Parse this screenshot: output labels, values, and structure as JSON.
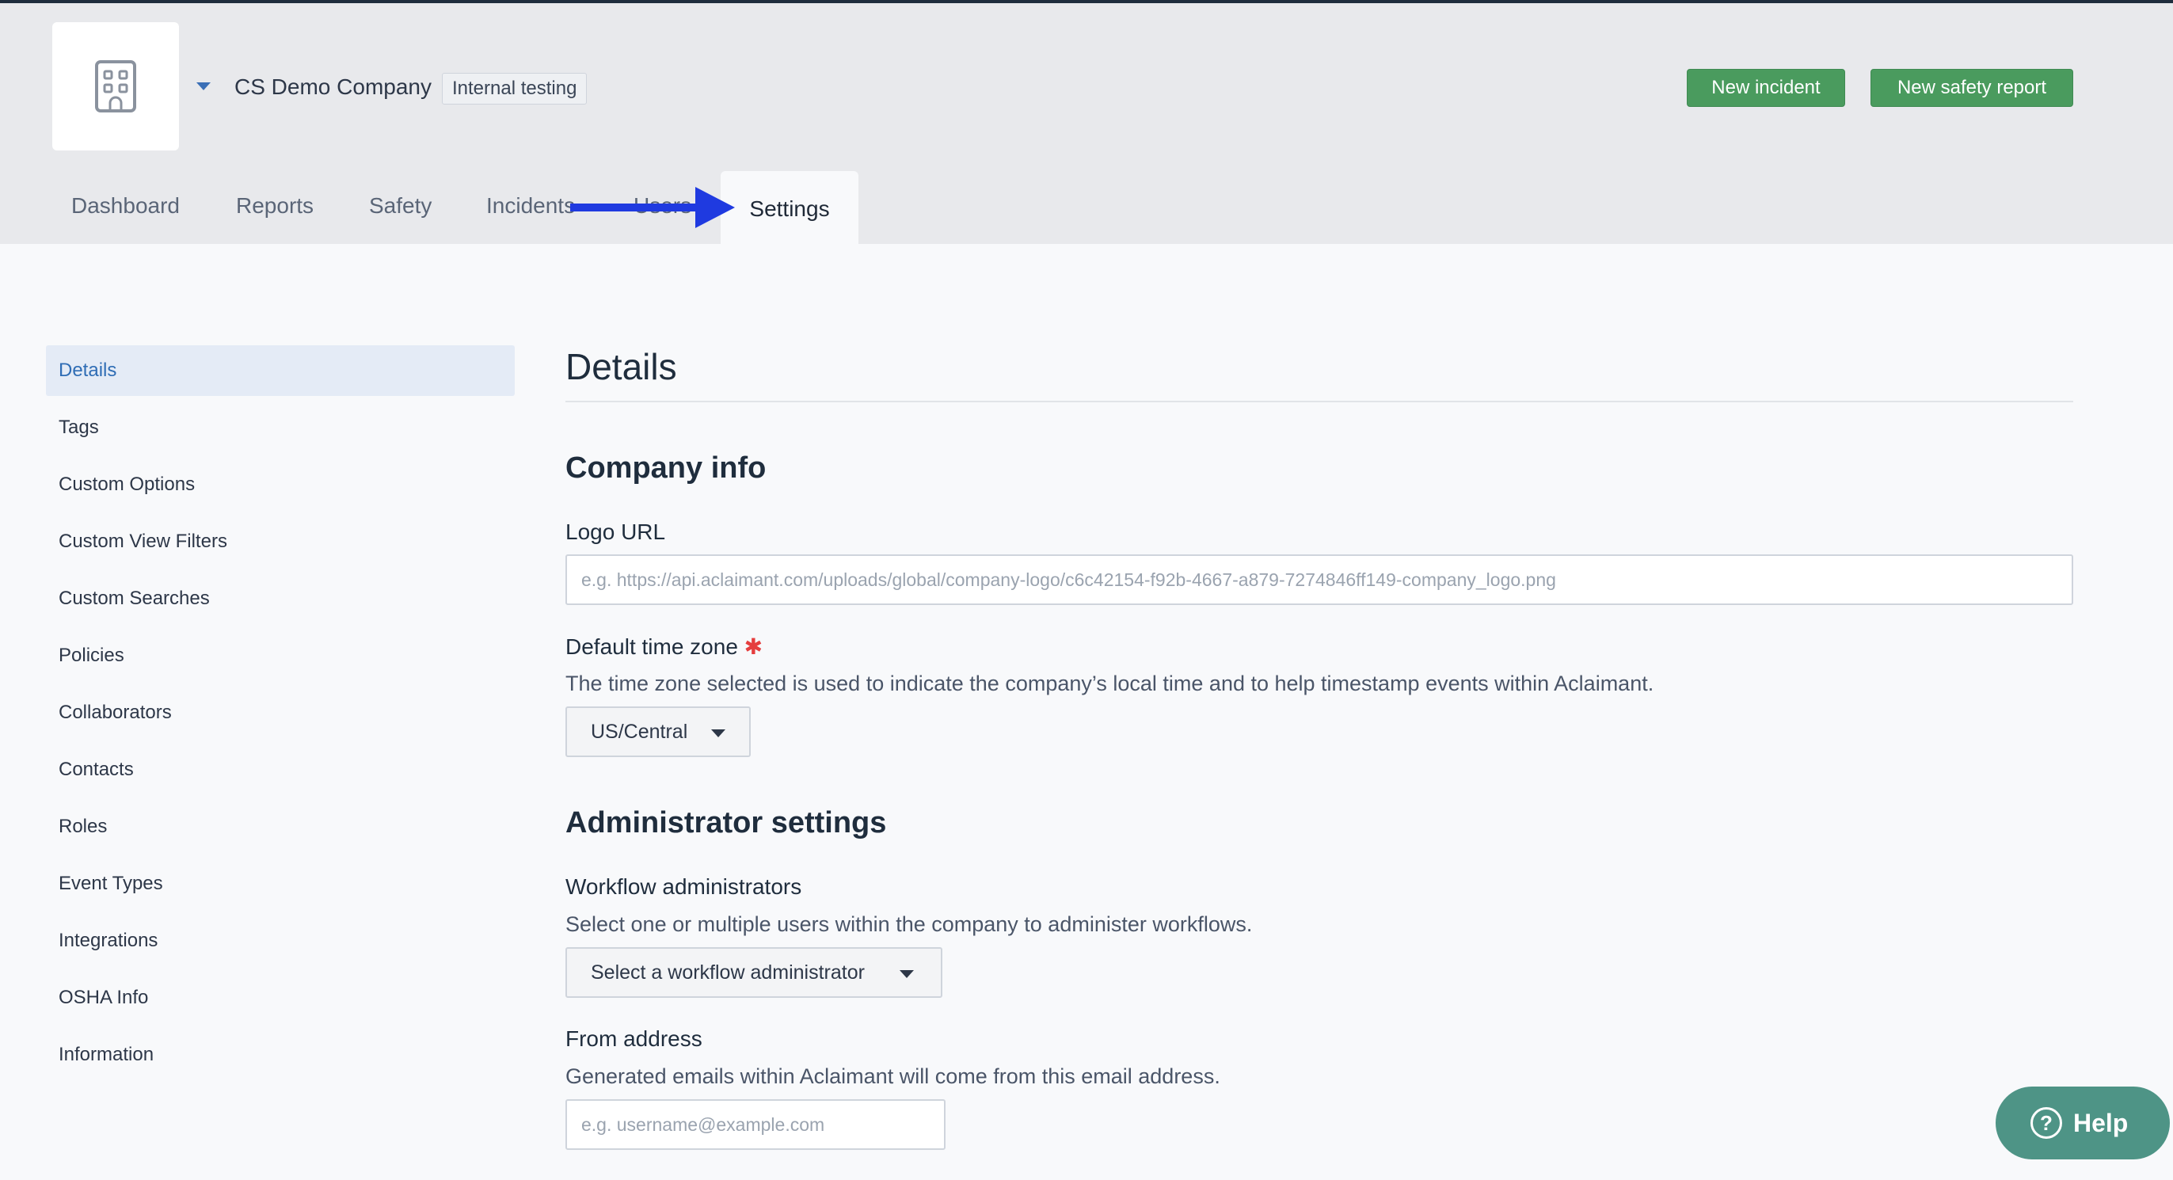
{
  "header": {
    "company_name": "CS Demo Company",
    "company_badge": "Internal testing",
    "new_incident": "New incident",
    "new_safety_report": "New safety report"
  },
  "tabs": [
    {
      "label": "Dashboard"
    },
    {
      "label": "Reports"
    },
    {
      "label": "Safety"
    },
    {
      "label": "Incidents"
    },
    {
      "label": "Users"
    },
    {
      "label": "Settings",
      "active": true
    }
  ],
  "sidebar": {
    "items": [
      {
        "label": "Details",
        "active": true
      },
      {
        "label": "Tags"
      },
      {
        "label": "Custom Options"
      },
      {
        "label": "Custom View Filters"
      },
      {
        "label": "Custom Searches"
      },
      {
        "label": "Policies"
      },
      {
        "label": "Collaborators"
      },
      {
        "label": "Contacts"
      },
      {
        "label": "Roles"
      },
      {
        "label": "Event Types"
      },
      {
        "label": "Integrations"
      },
      {
        "label": "OSHA Info"
      },
      {
        "label": "Information"
      }
    ]
  },
  "main": {
    "title": "Details",
    "company_info": {
      "heading": "Company info",
      "logo_label": "Logo URL",
      "logo_placeholder": "e.g. https://api.aclaimant.com/uploads/global/company-logo/c6c42154-f92b-4667-a879-7274846ff149-company_logo.png",
      "tz_label": "Default time zone",
      "tz_required": "✱",
      "tz_help": "The time zone selected is used to indicate the company’s local time and to help timestamp events within Aclaimant.",
      "tz_value": "US/Central"
    },
    "admin": {
      "heading": "Administrator settings",
      "workflow_label": "Workflow administrators",
      "workflow_help": "Select one or multiple users within the company to administer workflows.",
      "workflow_select": "Select a workflow administrator",
      "from_label": "From address",
      "from_help": "Generated emails within Aclaimant will come from this email address.",
      "from_placeholder": "e.g. username@example.com"
    }
  },
  "help": {
    "label": "Help",
    "icon": "question-circle-icon"
  },
  "colors": {
    "accent_blue": "#2f6db5",
    "button_green": "#4a9b5e",
    "help_teal": "#4e9486",
    "annotation_arrow": "#1f3ae0"
  }
}
